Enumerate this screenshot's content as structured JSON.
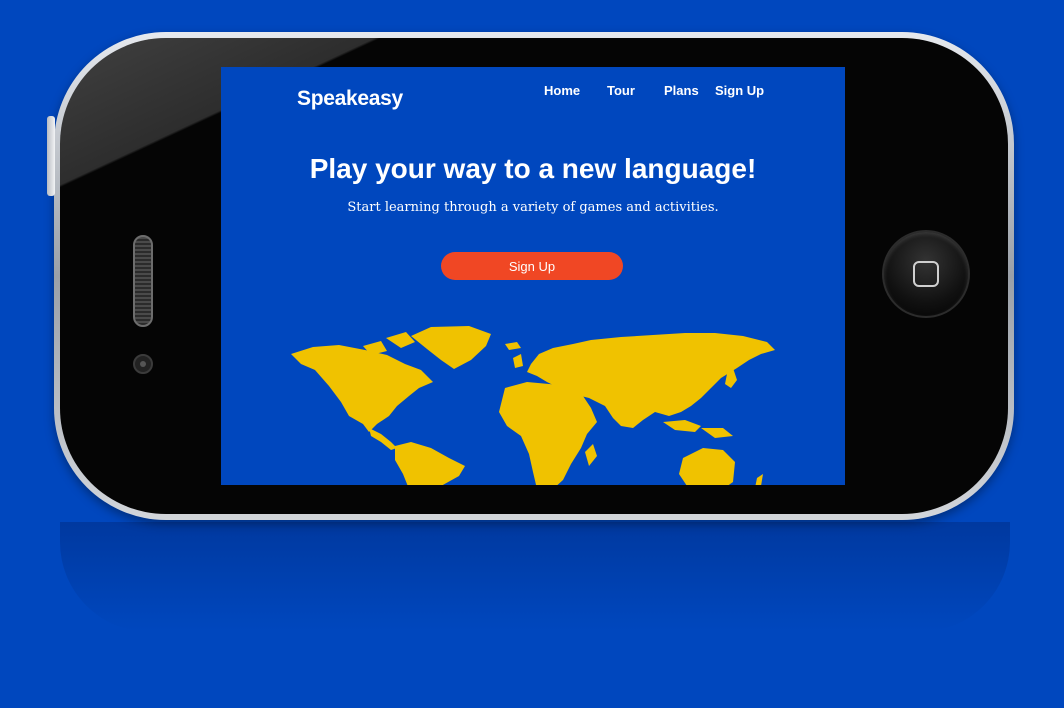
{
  "app": {
    "logo": "Speakeasy"
  },
  "nav": {
    "items": [
      {
        "label": "Home"
      },
      {
        "label": "Tour"
      },
      {
        "label": "Plans"
      },
      {
        "label": "Sign Up"
      }
    ]
  },
  "hero": {
    "title": "Play your way to a new language!",
    "subtitle": "Start learning through a variety of games and activities.",
    "cta_label": "Sign Up"
  },
  "colors": {
    "background": "#0047be",
    "cta": "#f04724",
    "map": "#f0c200"
  }
}
